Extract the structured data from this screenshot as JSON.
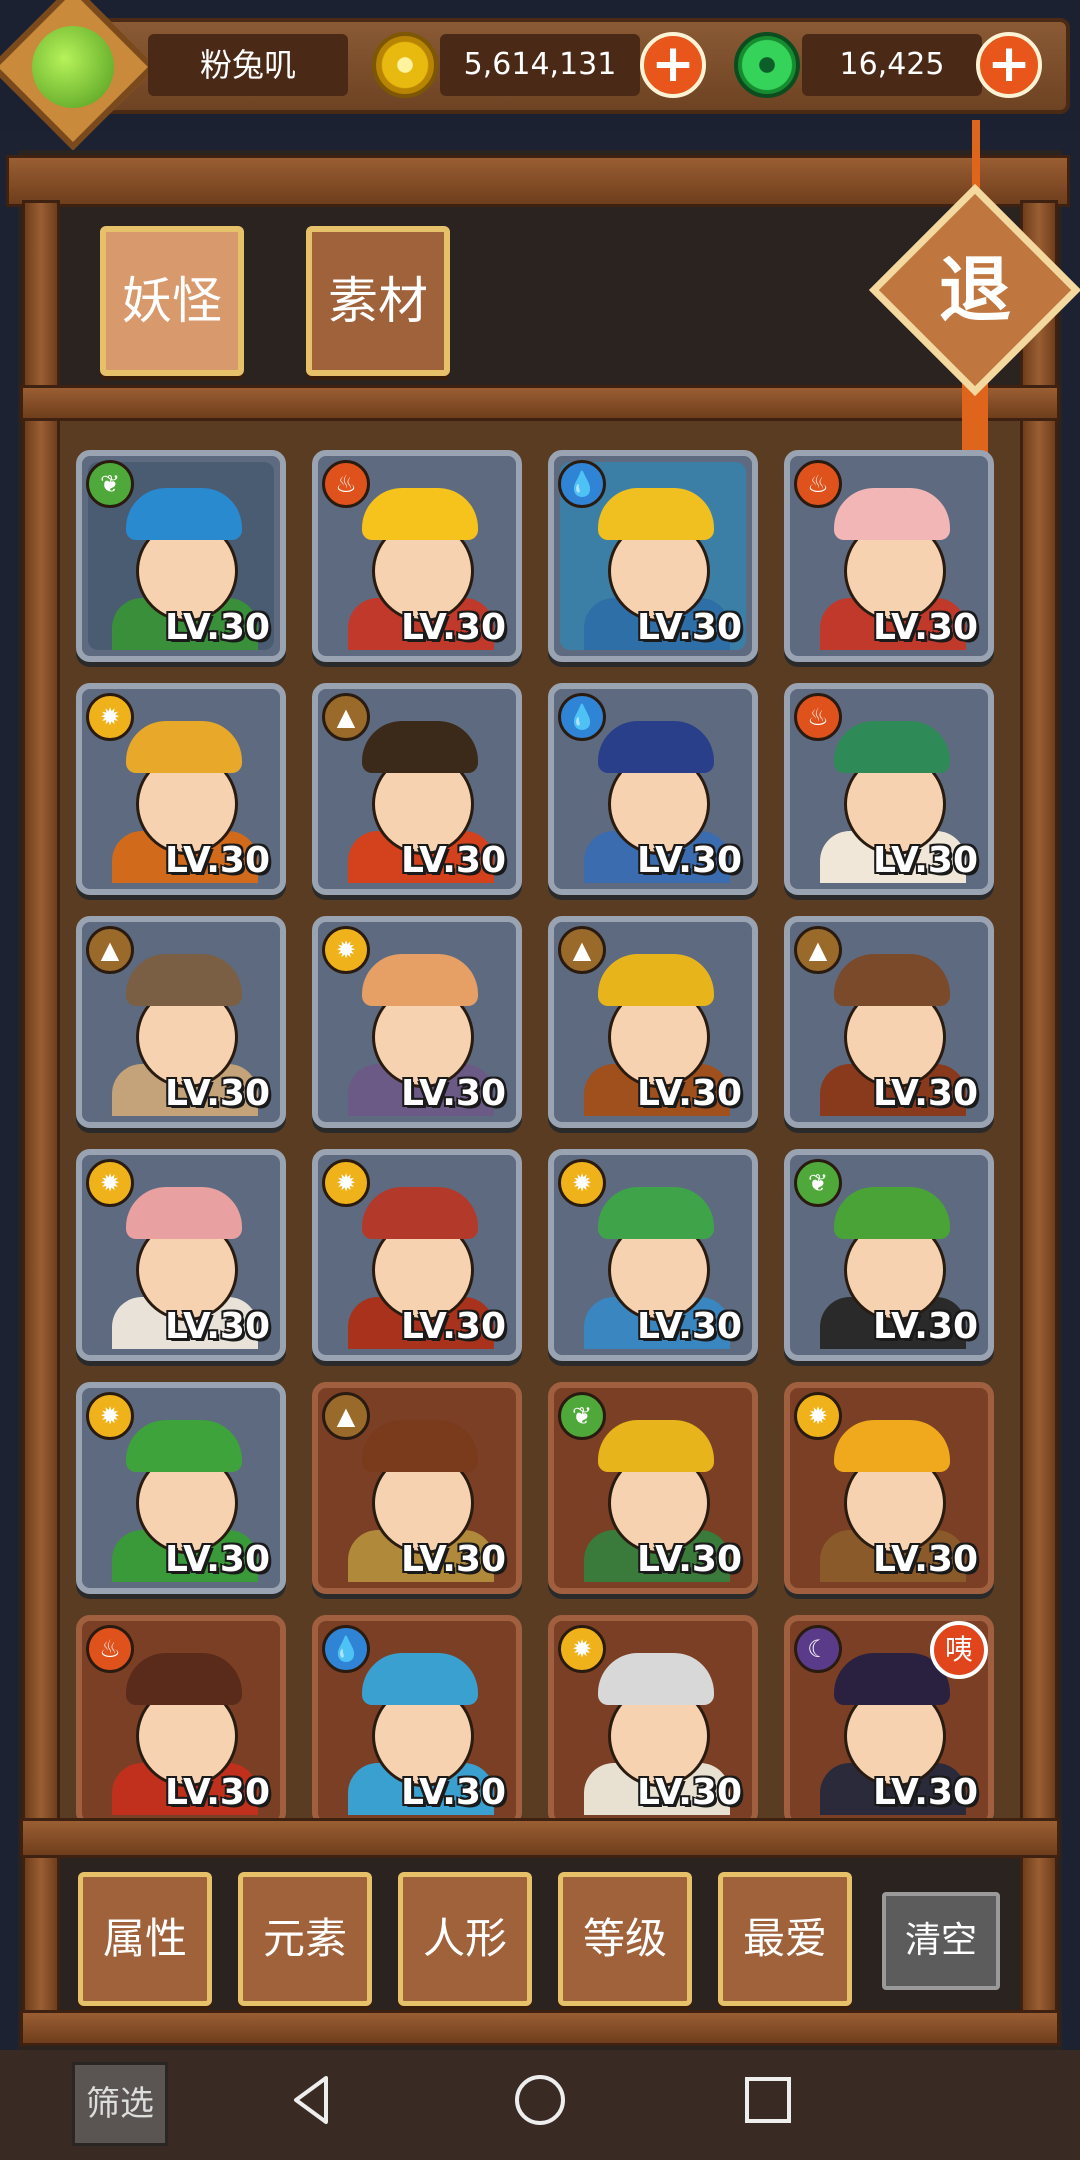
{
  "header": {
    "player_name": "粉兔叽",
    "gold": "5,614,131",
    "jade": "16,425",
    "plus": "+"
  },
  "tabs": [
    {
      "label": "妖怪"
    },
    {
      "label": "素材"
    }
  ],
  "exit_label": "退",
  "level_text": "LV.30",
  "cards": [
    {
      "element": "leaf",
      "frame": "silver",
      "hat": "#2a8ad0",
      "robe": "#3a8f3a",
      "bg": "#4a5c72"
    },
    {
      "element": "fire",
      "frame": "silver",
      "hat": "#f5c31c",
      "robe": "#c0392b",
      "bg": "#5d6a80"
    },
    {
      "element": "water",
      "frame": "silver",
      "hat": "#f0c020",
      "robe": "#2e6fa8",
      "bg": "#3c7fa6"
    },
    {
      "element": "fire",
      "frame": "silver",
      "hat": "#f3b6b6",
      "robe": "#c0392b",
      "bg": "#5d6a80"
    },
    {
      "element": "sun",
      "frame": "silver",
      "hat": "#e8a82a",
      "robe": "#d26a1c",
      "bg": "#5d6a80"
    },
    {
      "element": "earth",
      "frame": "silver",
      "hat": "#3b2a1a",
      "robe": "#d3421c",
      "bg": "#5d6a80"
    },
    {
      "element": "water",
      "frame": "silver",
      "hat": "#2a3f8a",
      "robe": "#3b6cb0",
      "bg": "#5d6a80"
    },
    {
      "element": "fire",
      "frame": "silver",
      "hat": "#2e8b57",
      "robe": "#f0e7d8",
      "bg": "#5d6a80"
    },
    {
      "element": "earth",
      "frame": "silver",
      "hat": "#7a5f45",
      "robe": "#c4a37a",
      "bg": "#5d6a80"
    },
    {
      "element": "sun",
      "frame": "silver",
      "hat": "#e6a066",
      "robe": "#6b5a86",
      "bg": "#5d6a80"
    },
    {
      "element": "earth",
      "frame": "silver",
      "hat": "#e8b41c",
      "robe": "#a0501c",
      "bg": "#5d6a80"
    },
    {
      "element": "earth",
      "frame": "silver",
      "hat": "#7a4a2a",
      "robe": "#8a3a1c",
      "bg": "#5d6a80"
    },
    {
      "element": "sun",
      "frame": "silver",
      "hat": "#e8a0a0",
      "robe": "#e8e2d8",
      "bg": "#5d6a80"
    },
    {
      "element": "sun",
      "frame": "silver",
      "hat": "#b33a2a",
      "robe": "#a8321c",
      "bg": "#5d6a80"
    },
    {
      "element": "sun",
      "frame": "silver",
      "hat": "#3fa34a",
      "robe": "#3a86c0",
      "bg": "#5d6a80"
    },
    {
      "element": "leaf",
      "frame": "silver",
      "hat": "#4aa336",
      "robe": "#2a2a2a",
      "bg": "#5d6a80"
    },
    {
      "element": "sun",
      "frame": "silver",
      "hat": "#3ea33a",
      "robe": "#3a9a3a",
      "bg": "#5d6a80"
    },
    {
      "element": "earth",
      "frame": "bronze",
      "hat": "#7a3a1c",
      "robe": "#b08a3a",
      "bg": "#7a3f24"
    },
    {
      "element": "leaf",
      "frame": "bronze",
      "hat": "#e8b41c",
      "robe": "#3a7a3a",
      "bg": "#7a3f24"
    },
    {
      "element": "sun",
      "frame": "bronze",
      "hat": "#f0a81c",
      "robe": "#8a5a2a",
      "bg": "#7a3f24"
    },
    {
      "element": "fire",
      "frame": "bronze",
      "hat": "#5a2a1a",
      "robe": "#c0301c",
      "bg": "#7a3f24"
    },
    {
      "element": "water",
      "frame": "bronze",
      "hat": "#3aa0d0",
      "robe": "#3aa0d0",
      "bg": "#7a3f24"
    },
    {
      "element": "sun",
      "frame": "bronze",
      "hat": "#d8d8d8",
      "robe": "#e8e0d0",
      "bg": "#7a3f24"
    },
    {
      "element": "moon",
      "frame": "bronze",
      "hat": "#2a2040",
      "robe": "#2a2a3a",
      "bg": "#7a3f24",
      "badge": "咦"
    }
  ],
  "filters": [
    {
      "label": "属性"
    },
    {
      "label": "元素"
    },
    {
      "label": "人形"
    },
    {
      "label": "等级"
    },
    {
      "label": "最爱"
    }
  ],
  "clear_label": "清空",
  "screen_filter_label": "筛选",
  "icons": {
    "element_icons": {
      "leaf": "❦",
      "fire": "♨",
      "water": "💧",
      "sun": "✹",
      "earth": "▲",
      "moon": "☾"
    }
  },
  "colors": {
    "wood": "#8a5a35",
    "plus": "#e8561c",
    "tab_border": "#e7c06a"
  }
}
